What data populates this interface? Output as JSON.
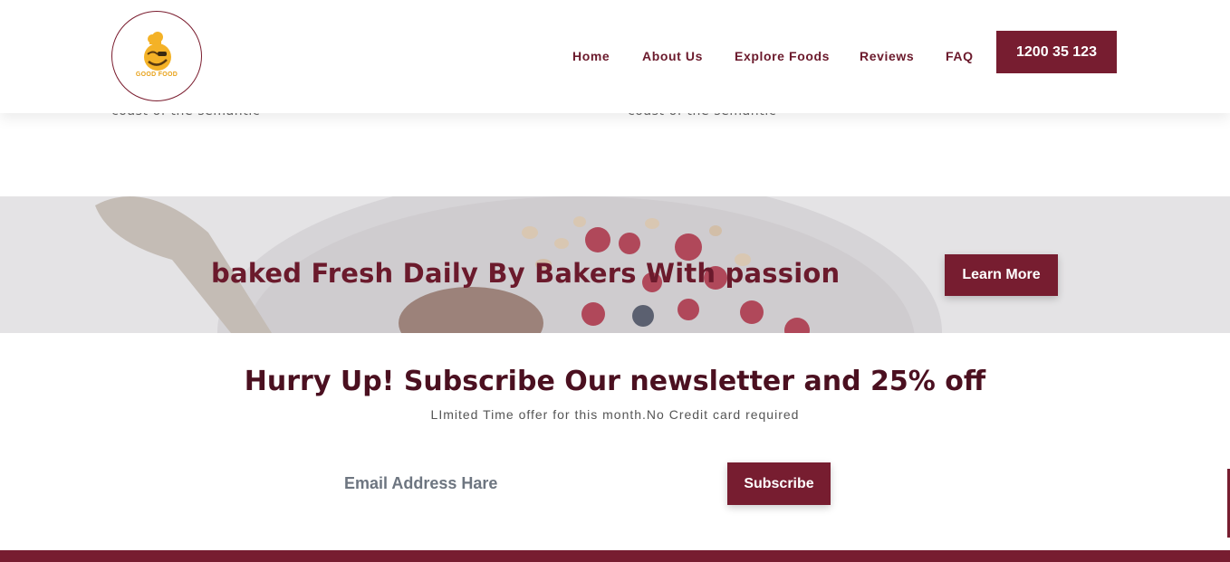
{
  "background_text": {
    "left": "coast of the semantic",
    "right": "coast of the semantic"
  },
  "header": {
    "logo_text": "GOOD FOOD",
    "nav": [
      {
        "label": "Home"
      },
      {
        "label": "About Us"
      },
      {
        "label": "Explore Foods"
      },
      {
        "label": "Reviews"
      },
      {
        "label": "FAQ"
      }
    ],
    "phone_label": "1200 35 123"
  },
  "banner": {
    "title": "baked Fresh Daily By Bakers With passion",
    "button_label": "Learn More"
  },
  "newsletter": {
    "title": "Hurry Up! Subscribe Our newsletter and 25% off",
    "subtitle": "LImited Time offer for this month.No Credit card required",
    "email_placeholder": "Email Address Hare",
    "button_label": "Subscribe"
  },
  "colors": {
    "brand": "#771d30",
    "logo_accent": "#e8a21a",
    "banner_bg": "#e4e3e5"
  },
  "icons": {
    "logo": "chef-emoji-logo-icon"
  }
}
